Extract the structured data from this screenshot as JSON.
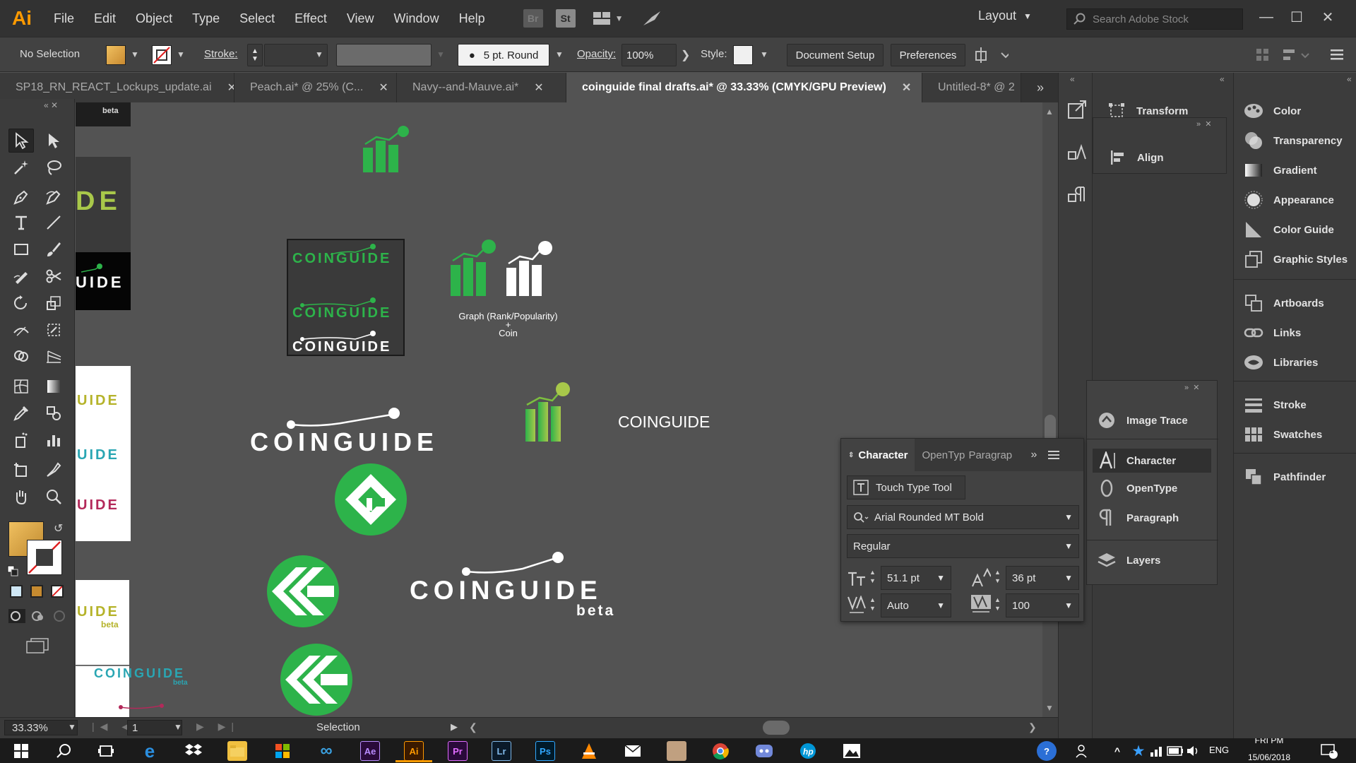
{
  "app": {
    "logo": "Ai"
  },
  "menu": [
    "File",
    "Edit",
    "Object",
    "Type",
    "Select",
    "Effect",
    "View",
    "Window",
    "Help"
  ],
  "bridge_labels": {
    "br": "Br",
    "st": "St"
  },
  "workspace": {
    "label": "Layout"
  },
  "stock_search": {
    "placeholder": "Search Adobe Stock"
  },
  "control_bar": {
    "selection": "No Selection",
    "stroke_label": "Stroke:",
    "brush": "5 pt. Round",
    "opacity_label": "Opacity:",
    "opacity_value": "100%",
    "style_label": "Style:",
    "document_setup": "Document Setup",
    "preferences": "Preferences"
  },
  "tabs": [
    {
      "label": "SP18_RN_REACT_Lockups_update.ai"
    },
    {
      "label": "Peach.ai* @ 25% (C..."
    },
    {
      "label": "Navy--and-Mauve.ai*"
    },
    {
      "label": "coinguide final drafts.ai* @ 33.33% (CMYK/GPU Preview)"
    },
    {
      "label": "Untitled-8* @ 2"
    }
  ],
  "canvas": {
    "logo_word": "COINGUIDE",
    "beta": "beta",
    "graph_caption_1": "Graph (Rank/Popularity)",
    "graph_caption_plus": "+",
    "graph_caption_2": "Coin",
    "side_left_text": "DE",
    "side_left_text2": "UIDE",
    "side_left_beta": "beta"
  },
  "status": {
    "zoom": "33.33%",
    "artboard": "1",
    "tool": "Selection"
  },
  "panels_mid": [
    {
      "label": "Transform",
      "icon": "transform-icon"
    },
    {
      "label": "Align",
      "icon": "align-icon"
    }
  ],
  "panels_group2": [
    {
      "label": "Image Trace",
      "icon": "image-trace-icon"
    },
    {
      "label": "Character",
      "icon": "character-icon"
    },
    {
      "label": "OpenType",
      "icon": "opentype-icon"
    },
    {
      "label": "Paragraph",
      "icon": "paragraph-icon"
    },
    {
      "label": "Layers",
      "icon": "layers-icon"
    }
  ],
  "panels_right": [
    {
      "label": "Color",
      "icon": "color-icon"
    },
    {
      "label": "Transparency",
      "icon": "transparency-icon"
    },
    {
      "label": "Gradient",
      "icon": "gradient-icon"
    },
    {
      "label": "Appearance",
      "icon": "appearance-icon"
    },
    {
      "label": "Color Guide",
      "icon": "color-guide-icon"
    },
    {
      "label": "Graphic Styles",
      "icon": "graphic-styles-icon"
    },
    {
      "label": "Artboards",
      "icon": "artboards-icon"
    },
    {
      "label": "Links",
      "icon": "links-icon"
    },
    {
      "label": "Libraries",
      "icon": "libraries-icon"
    },
    {
      "label": "Stroke",
      "icon": "stroke-icon"
    },
    {
      "label": "Swatches",
      "icon": "swatches-icon"
    },
    {
      "label": "Pathfinder",
      "icon": "pathfinder-icon"
    }
  ],
  "character_panel": {
    "tabs": [
      "Character",
      "OpenTyp",
      "Paragrap"
    ],
    "touch_type": "Touch Type Tool",
    "font_family": "Arial Rounded MT Bold",
    "font_style": "Regular",
    "font_size": "51.1 pt",
    "leading": "36 pt",
    "kerning": "Auto",
    "tracking": "100"
  },
  "taskbar": {
    "apps": [
      "Ae",
      "Ai",
      "Pr",
      "Lr",
      "Ps"
    ],
    "lang": "ENG",
    "time": "FRI PM",
    "date": "15/06/2018",
    "notif": "1"
  },
  "colors": {
    "brand_green": "#2db34a",
    "olive": "#b5b32a",
    "teal": "#2aa6b3",
    "maroon": "#b3295a",
    "ai_orange": "#ff9a00"
  }
}
